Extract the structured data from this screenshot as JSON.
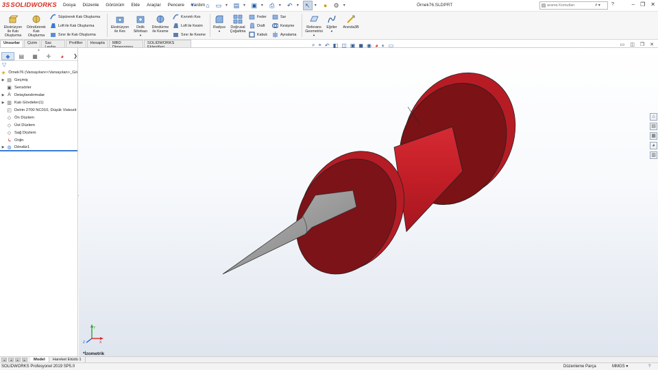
{
  "app": {
    "logo_prefix": "3S",
    "logo_text": "SOLIDWORKS",
    "document_title": "Örnek76.SLDPRT"
  },
  "menu": [
    "Dosya",
    "Düzenle",
    "Görünüm",
    "Ekle",
    "Araçlar",
    "Pencere",
    "Yardım"
  ],
  "search": {
    "placeholder": "arama Komutları"
  },
  "help_label": "?",
  "window_controls": [
    "–",
    "❐",
    "✕"
  ],
  "ribbon": {
    "extrude_boss": "Ekstrüzyon ile Katı Oluşturma",
    "revolve_boss": "Döndürerek Katı Oluşturma",
    "swept_boss": "Süpürerek Katı Oluşturma",
    "loft_boss": "Loft ile Katı Oluşturma",
    "boundary_boss": "Sınır ile Katı Oluşturma",
    "extrude_cut": "Ekstrüzyon ile Kes",
    "hole_wizard": "Delik Sihirbazı",
    "revolve_cut": "Döndürme ile Kesme",
    "swept_cut": "Kıvrımlı Kes",
    "loft_cut": "Loft ile Kesim",
    "boundary_cut": "Sınır ile Kesme",
    "fillet": "Radyus",
    "linear_pattern": "Doğrusal Çoğaltma",
    "rib": "Feder",
    "draft": "Draft",
    "shell": "Kabuk",
    "wrap": "Sar",
    "intersect": "Kesişme",
    "mirror": "Aynalama",
    "reference_geometry": "Referans Geometrisi",
    "curves": "Eğriler",
    "instant3d": "Anında3B"
  },
  "tabs": [
    "Unsurlar",
    "Çizim",
    "Sac Levha",
    "Profiller",
    "Hesapla",
    "MBD Dimensions",
    "SOLIDWORKS Eklentileri"
  ],
  "tree": {
    "root": "Örnek76  (Varsayılan<<Varsayılan>_Gö",
    "items": [
      {
        "label": "Geçmiş",
        "icon": "history-icon",
        "expandable": true
      },
      {
        "label": "Sensörler",
        "icon": "sensor-icon",
        "expandable": false
      },
      {
        "label": "Detaylandırmalar",
        "icon": "annotations-icon",
        "expandable": true
      },
      {
        "label": "Katı Gövdeler(1)",
        "icon": "solid-bodies-icon",
        "expandable": true
      },
      {
        "label": "Delrin 2700 NC010, Düşük Viskozit",
        "icon": "material-icon",
        "expandable": false
      },
      {
        "label": "Ön Düzlem",
        "icon": "plane-icon",
        "expandable": false
      },
      {
        "label": "Üst Düzlem",
        "icon": "plane-icon",
        "expandable": false
      },
      {
        "label": "Sağ Düzlem",
        "icon": "plane-icon",
        "expandable": false
      },
      {
        "label": "Orijin",
        "icon": "origin-icon",
        "expandable": false
      },
      {
        "label": "Döndür1",
        "icon": "revolve-feature-icon",
        "expandable": true
      }
    ]
  },
  "viewport": {
    "view_name": "*İzometrik",
    "triad_labels": {
      "x": "X",
      "y": "Y",
      "z": "Z"
    }
  },
  "bottom_tabs": [
    "Model",
    "Hareket Etüdü 1"
  ],
  "status": {
    "product": "SOLIDWORKS Profesyonel 2019 SP5.0",
    "mode": "Düzenleme Parça",
    "units": "MMGS",
    "units_arrow": "▾",
    "help_icon": "?"
  },
  "colors": {
    "part_red": "#c8202a",
    "part_red_dark": "#8e1b1f",
    "needle_gray": "#9b9b9b",
    "accent_blue": "#3a7bd5",
    "logo_red": "#d52b1e"
  }
}
